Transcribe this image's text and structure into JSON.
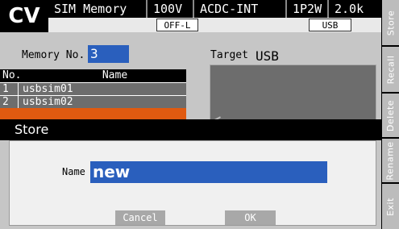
{
  "header": {
    "mode": "CV",
    "screen_title": "SIM Memory",
    "voltage_range": "100V",
    "signal_source": "ACDC-INT",
    "phase_wiring": "1P2W",
    "value": "2.0k",
    "output_state": "OFF-L",
    "media": "USB"
  },
  "softkeys": [
    "Store",
    "Recall",
    "Delete",
    "Rename",
    "Exit"
  ],
  "memory": {
    "label": "Memory No.",
    "number": "3",
    "target_label": "Target",
    "target_value": "USB"
  },
  "list": {
    "col_no": "No.",
    "col_name": "Name",
    "rows": [
      {
        "no": "1",
        "name": "usbsim01"
      },
      {
        "no": "2",
        "name": "usbsim02"
      }
    ]
  },
  "dialog": {
    "title": "Store",
    "name_label": "Name",
    "name_value": "new",
    "cancel_label": "Cancel",
    "ok_label": "OK"
  },
  "colors": {
    "accent": "#2a5fbd",
    "selected_row": "#e05a10",
    "row_bg": "#6d6d6d",
    "panel_bg": "#c6c6c6"
  }
}
